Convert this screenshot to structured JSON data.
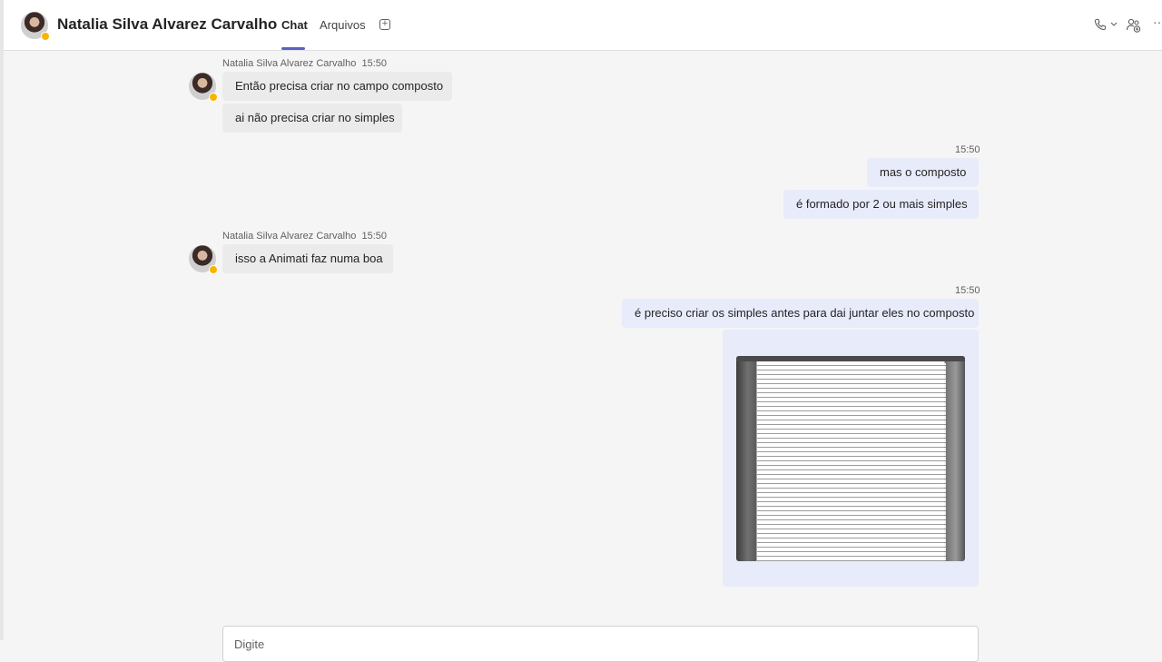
{
  "header": {
    "contact_name": "Natalia Silva Alvarez Carvalho",
    "tabs": [
      {
        "label": "Chat",
        "active": true
      },
      {
        "label": "Arquivos",
        "active": false
      }
    ],
    "icons": [
      "add-tab-icon",
      "call-icon",
      "chevron-down-icon",
      "people-add-icon",
      "more-icon"
    ]
  },
  "messages": [
    {
      "sender": "Natalia Silva Alvarez Carvalho",
      "time": "15:50",
      "direction": "in",
      "texts": [
        "Então precisa criar no campo composto",
        "ai não precisa criar no simples"
      ]
    },
    {
      "sender": "",
      "time": "15:50",
      "direction": "out",
      "texts": [
        "mas o composto",
        "é formado por 2 ou mais simples"
      ]
    },
    {
      "sender": "Natalia Silva Alvarez Carvalho",
      "time": "15:50",
      "direction": "in",
      "texts": [
        "isso a Animati faz numa boa"
      ]
    },
    {
      "sender": "",
      "time": "15:50",
      "direction": "out",
      "texts": [
        "é preciso criar os simples antes para dai juntar eles no composto"
      ],
      "attachment": "image"
    }
  ],
  "compose": {
    "placeholder": "Digite"
  },
  "colors": {
    "accent": "#5b5fc7",
    "outgoing_bubble": "#e8ebfa",
    "incoming_bubble": "#ebebeb",
    "presence_away": "#f8b400"
  }
}
